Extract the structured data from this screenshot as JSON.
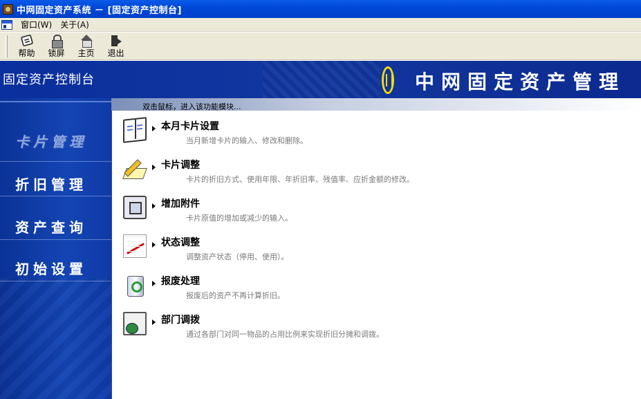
{
  "window": {
    "title": "中网固定资产系统 － [固定资产控制台]"
  },
  "menubar": {
    "items": [
      {
        "label": "窗口(W)"
      },
      {
        "label": "关于(A)"
      }
    ]
  },
  "toolbar": {
    "buttons": [
      {
        "label": "帮助",
        "icon": "help-book-icon"
      },
      {
        "label": "锁屏",
        "icon": "lock-icon"
      },
      {
        "label": "主页",
        "icon": "home-icon"
      },
      {
        "label": "退出",
        "icon": "exit-door-icon"
      }
    ]
  },
  "banner": {
    "console_title": "固定资产控制台",
    "product_name": "中网固定资产管理",
    "accent_color": "#f2dd00"
  },
  "leftnav": {
    "items": [
      {
        "label": "卡片管理",
        "active": true
      },
      {
        "label": "折旧管理",
        "active": false
      },
      {
        "label": "资产查询",
        "active": false
      },
      {
        "label": "初始设置",
        "active": false
      }
    ]
  },
  "content": {
    "hint": "双击鼠标，进入该功能模块...",
    "entries": [
      {
        "title": "本月卡片设置",
        "desc": "当月新增卡片的输入、修改和删除。",
        "icon": "card-book-icon"
      },
      {
        "title": "卡片调整",
        "desc": "卡片的折旧方式、使用年限、年折旧率、残值率、应折金额的修改。",
        "icon": "pencil-edit-icon"
      },
      {
        "title": "增加附件",
        "desc": "卡片原值的增加或减少的输入。",
        "icon": "attachment-icon"
      },
      {
        "title": "状态调整",
        "desc": "调整资产状态（停用、使用）。",
        "icon": "status-chart-icon"
      },
      {
        "title": "报废处理",
        "desc": "报废后的资产不再计算折旧。",
        "icon": "recycle-bin-icon"
      },
      {
        "title": "部门调拨",
        "desc": "通过各部门对同一物品的占用比例来实现折旧分摊和调拨。",
        "icon": "transfer-icon"
      }
    ]
  }
}
